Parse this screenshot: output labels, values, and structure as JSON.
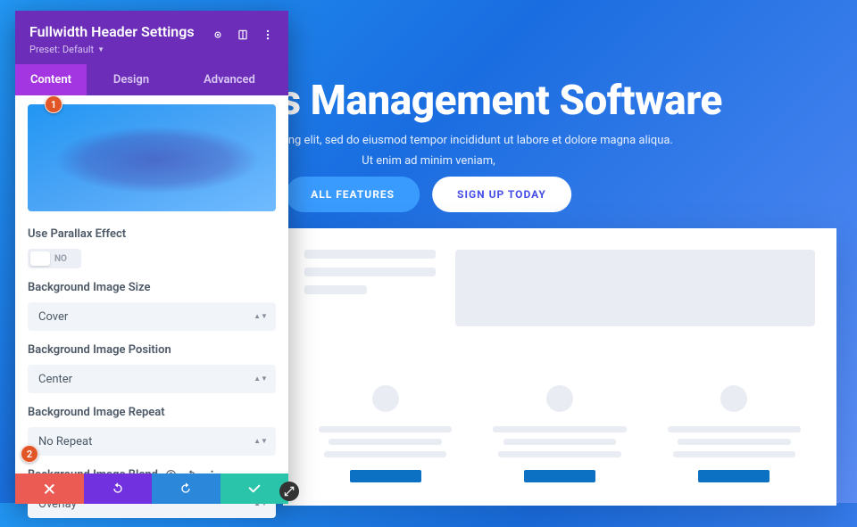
{
  "hero": {
    "title": "Business Management Software",
    "subtitle_line1": "consectetur adipiscing elit, sed do eiusmod tempor incididunt ut labore et dolore magna aliqua.",
    "subtitle_line2": "Ut enim ad minim veniam,",
    "btn_features": "ALL FEATURES",
    "btn_signup": "SIGN UP TODAY"
  },
  "panel": {
    "title": "Fullwidth Header Settings",
    "preset_label": "Preset: Default",
    "tabs": {
      "content": "Content",
      "design": "Design",
      "advanced": "Advanced"
    },
    "fields": {
      "parallax_label": "Use Parallax Effect",
      "parallax_value": "NO",
      "size_label": "Background Image Size",
      "size_value": "Cover",
      "position_label": "Background Image Position",
      "position_value": "Center",
      "repeat_label": "Background Image Repeat",
      "repeat_value": "No Repeat",
      "blend_label": "Background Image Blend",
      "blend_value": "Overlay"
    }
  },
  "badges": {
    "one": "1",
    "two": "2"
  }
}
